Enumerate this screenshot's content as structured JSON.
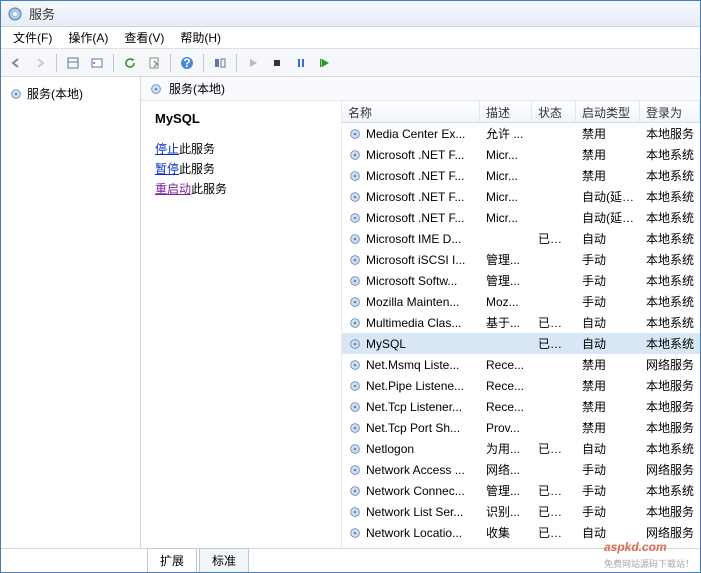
{
  "window": {
    "title": "服务"
  },
  "menu": {
    "file": "文件(F)",
    "action": "操作(A)",
    "view": "查看(V)",
    "help": "帮助(H)"
  },
  "tree": {
    "root": "服务(本地)"
  },
  "right_header": "服务(本地)",
  "detail": {
    "selected": "MySQL",
    "stop_link": "停止",
    "stop_suffix": "此服务",
    "pause_link": "暂停",
    "pause_suffix": "此服务",
    "restart_link": "重启动",
    "restart_suffix": "此服务"
  },
  "columns": {
    "name": "名称",
    "desc": "描述",
    "status": "状态",
    "start": "启动类型",
    "logon": "登录为"
  },
  "services": [
    {
      "name": "Media Center Ex...",
      "desc": "允许 ...",
      "status": "",
      "start": "禁用",
      "logon": "本地服务"
    },
    {
      "name": "Microsoft .NET F...",
      "desc": "Micr...",
      "status": "",
      "start": "禁用",
      "logon": "本地系统"
    },
    {
      "name": "Microsoft .NET F...",
      "desc": "Micr...",
      "status": "",
      "start": "禁用",
      "logon": "本地系统"
    },
    {
      "name": "Microsoft .NET F...",
      "desc": "Micr...",
      "status": "",
      "start": "自动(延迟...",
      "logon": "本地系统"
    },
    {
      "name": "Microsoft .NET F...",
      "desc": "Micr...",
      "status": "",
      "start": "自动(延迟...",
      "logon": "本地系统"
    },
    {
      "name": "Microsoft IME D...",
      "desc": "",
      "status": "已启动",
      "start": "自动",
      "logon": "本地系统"
    },
    {
      "name": "Microsoft iSCSI I...",
      "desc": "管理...",
      "status": "",
      "start": "手动",
      "logon": "本地系统"
    },
    {
      "name": "Microsoft Softw...",
      "desc": "管理...",
      "status": "",
      "start": "手动",
      "logon": "本地系统"
    },
    {
      "name": "Mozilla Mainten...",
      "desc": "Moz...",
      "status": "",
      "start": "手动",
      "logon": "本地系统"
    },
    {
      "name": "Multimedia Clas...",
      "desc": "基于...",
      "status": "已启动",
      "start": "自动",
      "logon": "本地系统"
    },
    {
      "name": "MySQL",
      "desc": "",
      "status": "已启动",
      "start": "自动",
      "logon": "本地系统",
      "selected": true
    },
    {
      "name": "Net.Msmq Liste...",
      "desc": "Rece...",
      "status": "",
      "start": "禁用",
      "logon": "网络服务"
    },
    {
      "name": "Net.Pipe Listene...",
      "desc": "Rece...",
      "status": "",
      "start": "禁用",
      "logon": "本地服务"
    },
    {
      "name": "Net.Tcp Listener...",
      "desc": "Rece...",
      "status": "",
      "start": "禁用",
      "logon": "本地服务"
    },
    {
      "name": "Net.Tcp Port Sh...",
      "desc": "Prov...",
      "status": "",
      "start": "禁用",
      "logon": "本地服务"
    },
    {
      "name": "Netlogon",
      "desc": "为用...",
      "status": "已启动",
      "start": "自动",
      "logon": "本地系统"
    },
    {
      "name": "Network Access ...",
      "desc": "网络...",
      "status": "",
      "start": "手动",
      "logon": "网络服务"
    },
    {
      "name": "Network Connec...",
      "desc": "管理...",
      "status": "已启动",
      "start": "手动",
      "logon": "本地系统"
    },
    {
      "name": "Network List Ser...",
      "desc": "识别...",
      "status": "已启动",
      "start": "手动",
      "logon": "本地服务"
    },
    {
      "name": "Network Locatio...",
      "desc": "收集",
      "status": "已启动",
      "start": "自动",
      "logon": "网络服务"
    }
  ],
  "tabs": {
    "extended": "扩展",
    "standard": "标准"
  },
  "watermark": {
    "main": "aspkd.com",
    "sub": "免费网站源码下载站！"
  }
}
